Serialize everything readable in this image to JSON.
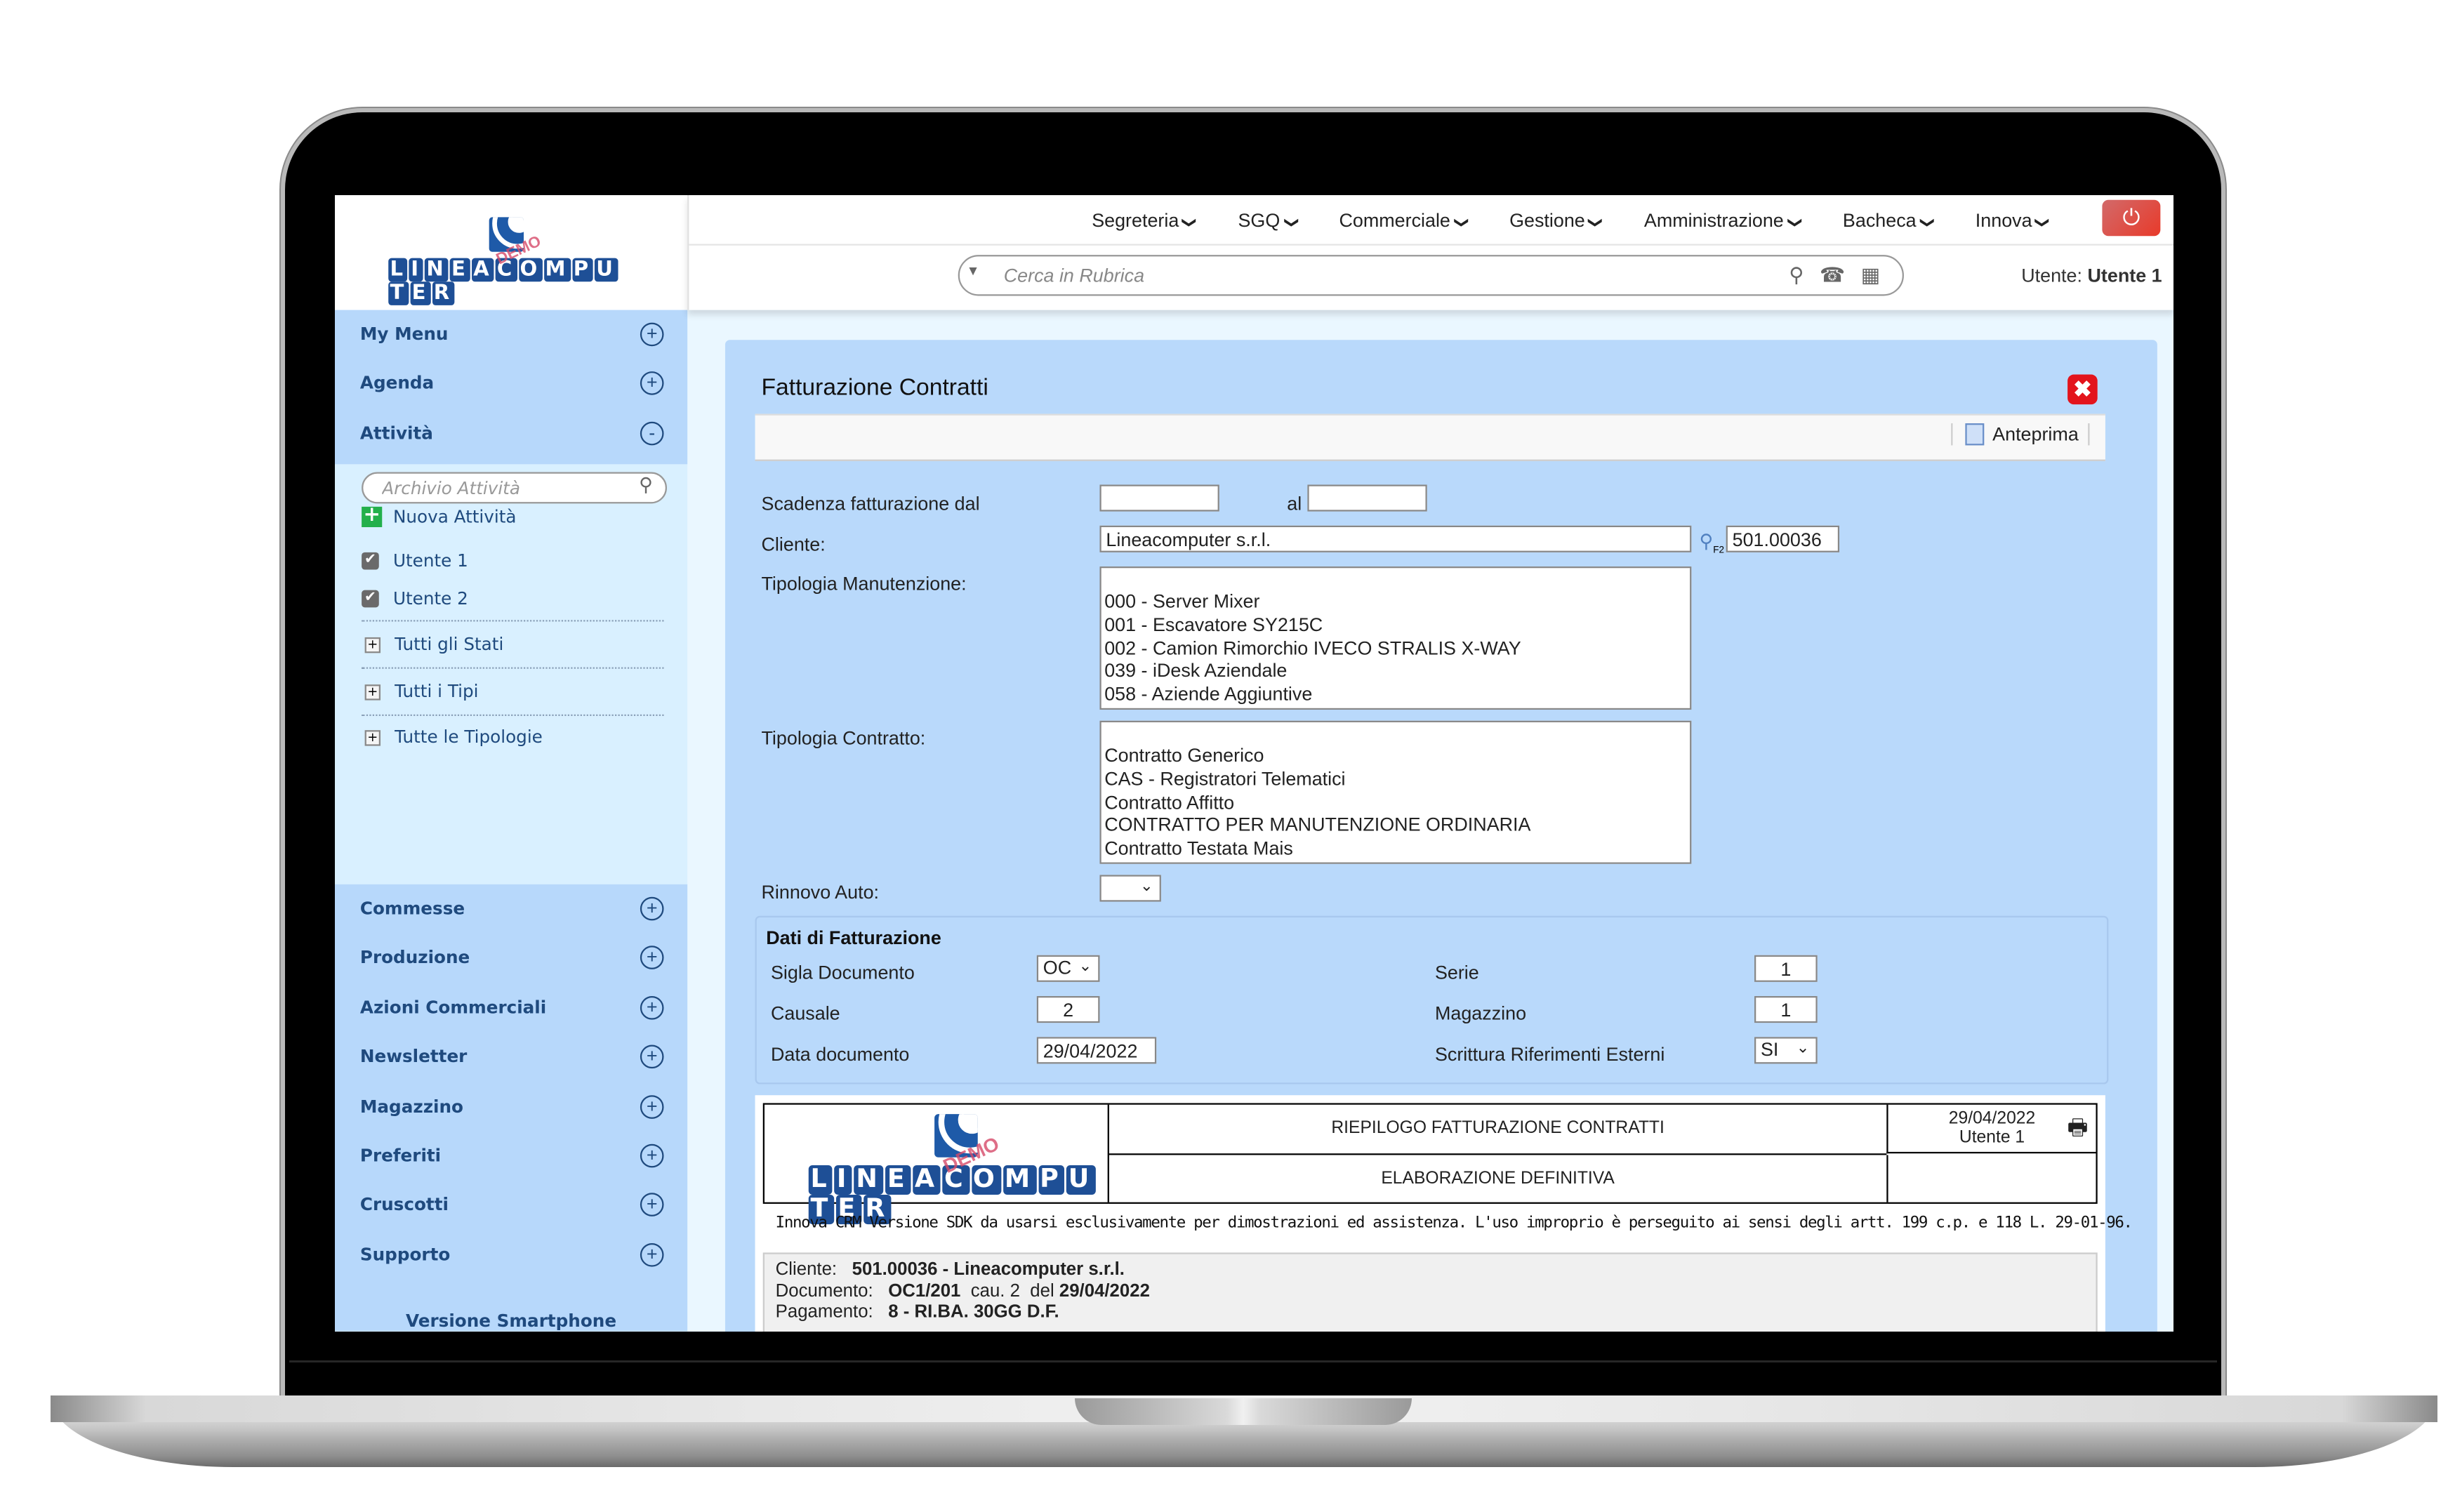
{
  "brand": {
    "logo_text": "LINEACOMPUTER",
    "demo_stamp": "DEMO"
  },
  "topnav": {
    "items": [
      {
        "label": "Segreteria"
      },
      {
        "label": "SGQ"
      },
      {
        "label": "Commerciale"
      },
      {
        "label": "Gestione"
      },
      {
        "label": "Amministrazione"
      },
      {
        "label": "Bacheca"
      },
      {
        "label": "Innova"
      }
    ],
    "chevron": "⌄",
    "power_icon": "⏻"
  },
  "search": {
    "placeholder": "Cerca in Rubrica",
    "icons": [
      "search-icon",
      "phone-icon",
      "calendar-icon"
    ]
  },
  "user": {
    "label": "Utente:",
    "name": "Utente 1"
  },
  "sidebar": {
    "top_items": [
      {
        "label": "My Menu",
        "toggle": "+"
      },
      {
        "label": "Agenda",
        "toggle": "+"
      },
      {
        "label": "Attività",
        "toggle": "-"
      }
    ],
    "attivita": {
      "search_placeholder": "Archivio Attività",
      "new_label": "Nuova Attività",
      "users": [
        {
          "label": "Utente 1",
          "checked": true
        },
        {
          "label": "Utente 2",
          "checked": true
        }
      ],
      "filters": [
        {
          "label": "Tutti gli Stati"
        },
        {
          "label": "Tutti i Tipi"
        },
        {
          "label": "Tutte le Tipologie"
        }
      ]
    },
    "bottom_items": [
      {
        "label": "Commesse",
        "toggle": "+"
      },
      {
        "label": "Produzione",
        "toggle": "+"
      },
      {
        "label": "Azioni Commerciali",
        "toggle": "+"
      },
      {
        "label": "Newsletter",
        "toggle": "+"
      },
      {
        "label": "Magazzino",
        "toggle": "+"
      },
      {
        "label": "Preferiti",
        "toggle": "+"
      },
      {
        "label": "Cruscotti",
        "toggle": "+"
      },
      {
        "label": "Supporto",
        "toggle": "+"
      }
    ],
    "version_link": "Versione Smartphone"
  },
  "panel": {
    "title": "Fatturazione Contratti",
    "close_icon": "✖",
    "toolbar": {
      "preview_label": "Anteprima"
    },
    "form": {
      "scadenza_label": "Scadenza fatturazione dal",
      "scadenza_from": "",
      "al_label": "al",
      "scadenza_to": "",
      "cliente_label": "Cliente:",
      "cliente_value": "Lineacomputer s.r.l.",
      "cliente_code": "501.00036",
      "lookup_hint": "F2",
      "manutenzione_label": "Tipologia Manutenzione:",
      "manutenzione_options": [
        "000 - Server Mixer",
        "001 - Escavatore SY215C",
        "002 - Camion Rimorchio IVECO STRALIS X-WAY",
        "039 - iDesk Aziendale",
        "058 - Aziende Aggiuntive"
      ],
      "contratto_label": "Tipologia Contratto:",
      "contratto_options": [
        "Contratto Generico",
        "CAS - Registratori Telematici",
        "Contratto Affitto",
        "CONTRATTO PER MANUTENZIONE ORDINARIA",
        "Contratto Testata Mais"
      ],
      "rinnovo_label": "Rinnovo Auto:",
      "rinnovo_value": ""
    },
    "fatturazione": {
      "title": "Dati di Fatturazione",
      "sigla_label": "Sigla Documento",
      "sigla_value": "OC",
      "causale_label": "Causale",
      "causale_value": "2",
      "data_label": "Data documento",
      "data_value": "29/04/2022",
      "serie_label": "Serie",
      "serie_value": "1",
      "magazzino_label": "Magazzino",
      "magazzino_value": "1",
      "scrittura_label": "Scrittura Riferimenti Esterni",
      "scrittura_value": "SI"
    },
    "report": {
      "title": "RIEPILOGO FATTURAZIONE CONTRATTI",
      "subtitle": "ELABORAZIONE DEFINITIVA",
      "date": "29/04/2022",
      "user": "Utente 1",
      "print_icon": "🖶",
      "note": "Innova CRM Versione SDK da usarsi esclusivamente per dimostrazioni ed assistenza. L'uso improprio è perseguito ai sensi degli artt. 199 c.p. e 118 L. 29-01-96.",
      "cliente_label": "Cliente:",
      "cliente_value": "501.00036 - Lineacomputer s.r.l.",
      "documento_label": "Documento:",
      "documento_code": "OC1/201",
      "documento_cau": "cau. 2",
      "documento_del": "del",
      "documento_date": "29/04/2022",
      "pagamento_label": "Pagamento:",
      "pagamento_value": "8 - RI.BA. 30GG D.F."
    }
  }
}
